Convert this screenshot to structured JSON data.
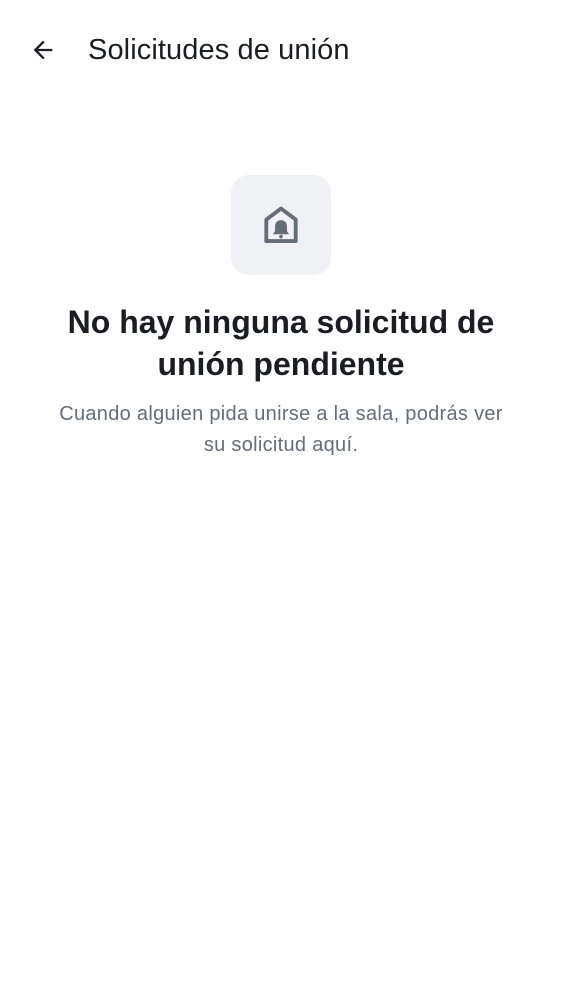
{
  "header": {
    "title": "Solicitudes de unión",
    "back_icon": "arrow-left-icon"
  },
  "empty_state": {
    "icon": "home-bell-icon",
    "title": "No hay ninguna solicitud de unión pendiente",
    "subtitle": "Cuando alguien pida unirse a la sala, podrás ver su solicitud aquí."
  },
  "colors": {
    "background": "#ffffff",
    "text_primary": "#1b1d22",
    "text_secondary": "#656d77",
    "icon_tile": "#eff1f5",
    "icon": "#656d77"
  }
}
